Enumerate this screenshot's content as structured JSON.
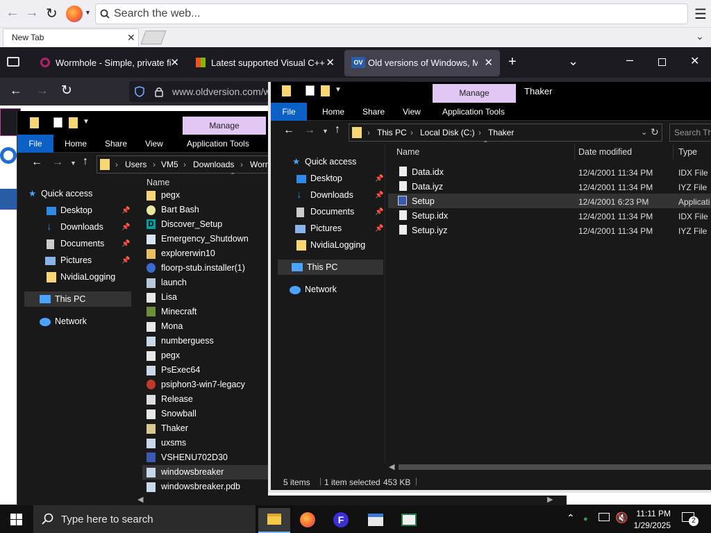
{
  "outer_browser": {
    "search_placeholder": "Search the web...",
    "tab_label": "New Tab"
  },
  "inner_browser": {
    "tabs": [
      {
        "label": "Wormhole - Simple, private file",
        "icon": "wormhole-icon"
      },
      {
        "label": "Latest supported Visual C++ Re",
        "icon": "microsoft-icon"
      },
      {
        "label": "Old versions of Windows, Mac",
        "icon": "ov-icon",
        "favicon_text": "OV"
      }
    ],
    "url": "www.oldversion.com/w"
  },
  "explorer_left": {
    "manage_label": "Manage",
    "menu": [
      "File",
      "Home",
      "Share",
      "View",
      "Application Tools"
    ],
    "breadcrumb": [
      "Users",
      "VM5",
      "Downloads",
      "Worm"
    ],
    "nav": [
      {
        "label": "Quick access",
        "icon": "star-icon"
      },
      {
        "label": "Desktop",
        "icon": "desktop-icon",
        "pinned": true
      },
      {
        "label": "Downloads",
        "icon": "download-icon",
        "pinned": true
      },
      {
        "label": "Documents",
        "icon": "document-icon",
        "pinned": true
      },
      {
        "label": "Pictures",
        "icon": "pictures-icon",
        "pinned": true
      },
      {
        "label": "NvidiaLogging",
        "icon": "folder-icon"
      },
      {
        "label": "This PC",
        "icon": "pc-icon"
      },
      {
        "label": "Network",
        "icon": "network-icon"
      }
    ],
    "column_name": "Name",
    "files": [
      "pegx",
      "Bart Bash",
      "Discover_Setup",
      "Emergency_Shutdown",
      "explorerwin10",
      "floorp-stub.installer(1)",
      "launch",
      "Lisa",
      "Minecraft",
      "Mona",
      "numberguess",
      "pegx",
      "PsExec64",
      "psiphon3-win7-legacy",
      "Release",
      "Snowball",
      "Thaker",
      "uxsms",
      "VSHENU702D30",
      "windowsbreaker",
      "windowsbreaker.pdb"
    ]
  },
  "explorer_right": {
    "manage_label": "Manage",
    "title": "Thaker",
    "menu": [
      "File",
      "Home",
      "Share",
      "View",
      "Application Tools"
    ],
    "breadcrumb": [
      "This PC",
      "Local Disk (C:)",
      "Thaker"
    ],
    "search_placeholder": "Search Th",
    "nav": [
      {
        "label": "Quick access",
        "icon": "star-icon"
      },
      {
        "label": "Desktop",
        "icon": "desktop-icon",
        "pinned": true
      },
      {
        "label": "Downloads",
        "icon": "download-icon",
        "pinned": true
      },
      {
        "label": "Documents",
        "icon": "document-icon",
        "pinned": true
      },
      {
        "label": "Pictures",
        "icon": "pictures-icon",
        "pinned": true
      },
      {
        "label": "NvidiaLogging",
        "icon": "folder-icon"
      },
      {
        "label": "This PC",
        "icon": "pc-icon"
      },
      {
        "label": "Network",
        "icon": "network-icon"
      }
    ],
    "columns": {
      "name": "Name",
      "date": "Date modified",
      "type": "Type"
    },
    "files": [
      {
        "name": "Data.idx",
        "date": "12/4/2001 11:34 PM",
        "type": "IDX File"
      },
      {
        "name": "Data.iyz",
        "date": "12/4/2001 11:34 PM",
        "type": "IYZ File"
      },
      {
        "name": "Setup",
        "date": "12/4/2001 6:23 PM",
        "type": "Applicati"
      },
      {
        "name": "Setup.idx",
        "date": "12/4/2001 11:34 PM",
        "type": "IDX File"
      },
      {
        "name": "Setup.iyz",
        "date": "12/4/2001 11:34 PM",
        "type": "IYZ File"
      }
    ],
    "status": {
      "count": "5 items",
      "selected": "1 item selected",
      "size": "453 KB"
    }
  },
  "taskbar": {
    "search_placeholder": "Type here to search",
    "time": "11:11 PM",
    "date": "1/29/2025",
    "notification_count": "2"
  }
}
